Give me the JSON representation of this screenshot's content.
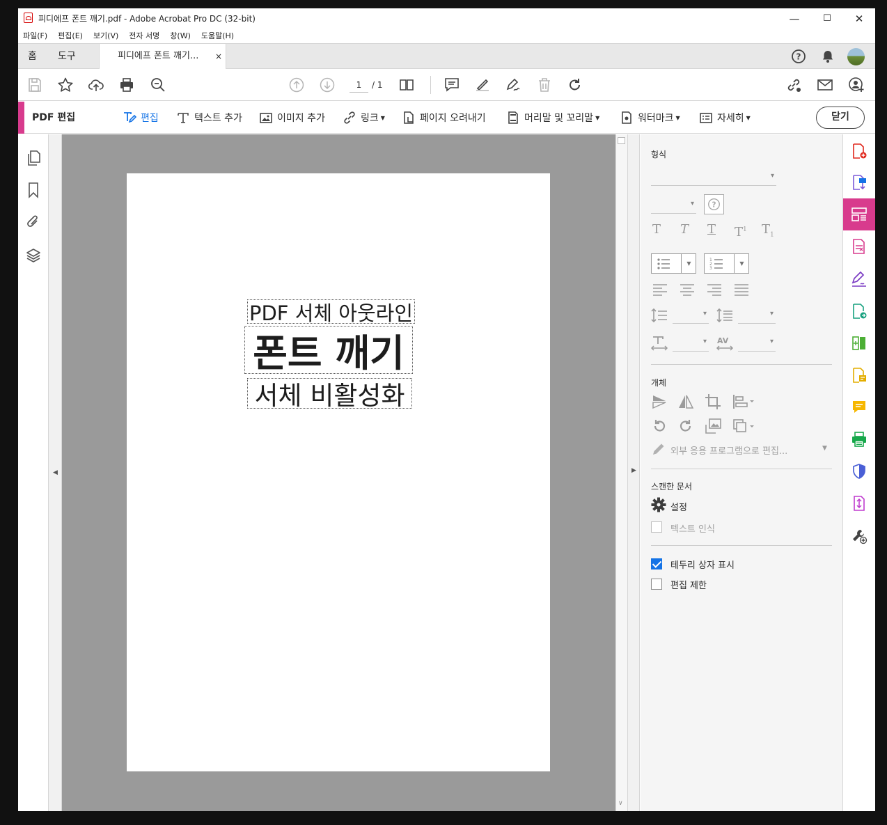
{
  "window": {
    "title": "피디에프 폰트 깨기.pdf - Adobe Acrobat Pro DC (32-bit)",
    "minimize": "—",
    "maximize": "☐",
    "close": "✕"
  },
  "menu": [
    "파일(F)",
    "편집(E)",
    "보기(V)",
    "전자 서명",
    "창(W)",
    "도움말(H)"
  ],
  "tabs": {
    "home": "홈",
    "tools": "도구",
    "doc": "피디에프 폰트 깨기...",
    "doc_close": "×"
  },
  "toolbar": {
    "page_current": "1",
    "page_total": "/ 1"
  },
  "editbar": {
    "title": "PDF 편집",
    "items": [
      "편집",
      "텍스트 추가",
      "이미지 추가",
      "링크",
      "페이지 오려내기",
      "머리말 및 꼬리말",
      "워터마크",
      "자세히"
    ],
    "close": "닫기"
  },
  "document": {
    "line1": "PDF 서체 아웃라인",
    "line2": "폰트 깨기",
    "line3": "서체 비활성화"
  },
  "panel": {
    "format_header": "형식",
    "object_header": "개체",
    "external_edit": "외부 응용 프로그램으로 편집...",
    "scanned_header": "스캔한 문서",
    "settings": "설정",
    "ocr": "텍스트 인식",
    "show_bbox": "테두리 상자 표시",
    "restrict_edit": "편집 제한"
  },
  "colors": {
    "accent": "#d83b8d",
    "checkbox": "#1473e6"
  }
}
